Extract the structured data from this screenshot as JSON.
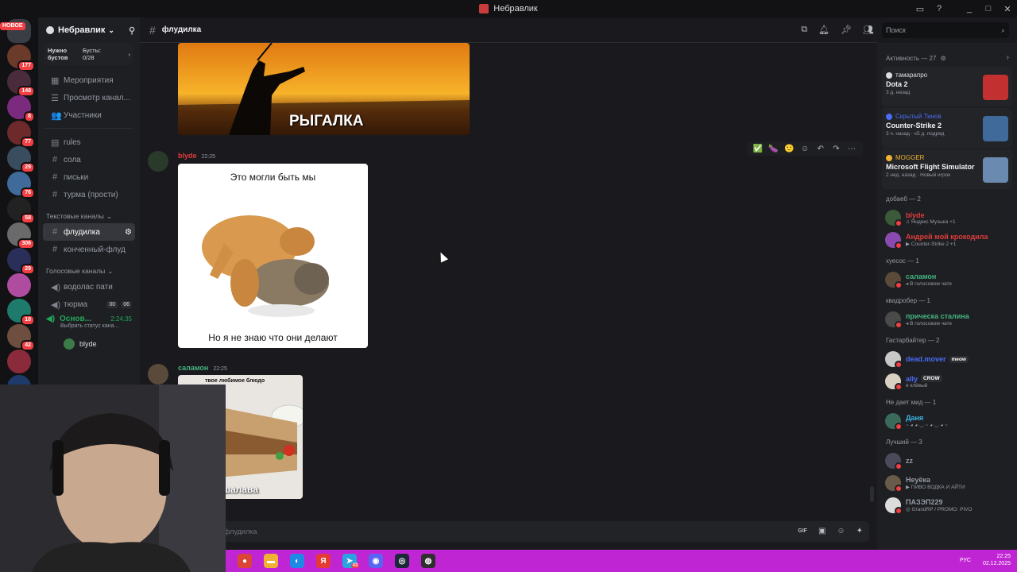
{
  "window": {
    "title": "Небравлик",
    "controls": [
      "_",
      "□",
      "✕"
    ]
  },
  "servers": [
    {
      "badge": "",
      "new_tag": "НОВОЕ",
      "color": "#3a3d44"
    },
    {
      "badge": "177",
      "color": "#6c3a2a"
    },
    {
      "badge": "148",
      "color": "#4a2b3c"
    },
    {
      "badge": "8",
      "color": "#7a2b7e"
    },
    {
      "badge": "77",
      "color": "#6e2a2a"
    },
    {
      "badge": "29",
      "color": "#3a4d5e"
    },
    {
      "badge": "76",
      "color": "#3f6a9a"
    },
    {
      "badge": "58",
      "color": "#222"
    },
    {
      "badge": "306",
      "color": "#6a6a6a"
    },
    {
      "badge": "29",
      "color": "#2a2f5a"
    },
    {
      "badge": "",
      "color": "#b04ca0"
    },
    {
      "badge": "10",
      "color": "#1e7a6a"
    },
    {
      "badge": "42",
      "color": "#6e4e3e"
    },
    {
      "badge": "",
      "color": "#8a2a3a"
    },
    {
      "badge": "",
      "color": "#1e3a6a"
    }
  ],
  "server": {
    "name": "Небравлик",
    "boost_left": "Нужно бустов",
    "boost_right": "Бусты: 0/28",
    "top_items": [
      {
        "icon": "calendar-icon",
        "glyph": "▦",
        "label": "Мероприятия"
      },
      {
        "icon": "browse-channels-icon",
        "glyph": "☰",
        "label": "Просмотр канал..."
      },
      {
        "icon": "members-icon",
        "glyph": "👥",
        "label": "Участники"
      }
    ],
    "text_top": [
      {
        "glyph": "▤",
        "label": "rules"
      },
      {
        "glyph": "#",
        "label": "сола"
      },
      {
        "glyph": "#",
        "label": "письки"
      },
      {
        "glyph": "#",
        "label": "турма (прости)"
      }
    ],
    "text_category": "Текстовые каналы",
    "text_channels": [
      {
        "glyph": "#",
        "label": "флудилка",
        "active": true
      },
      {
        "glyph": "#",
        "label": "конченный-флуд",
        "active": false
      }
    ],
    "voice_category": "Голосовые каналы",
    "voice_channels": [
      {
        "label": "водолас пати"
      },
      {
        "label": "тюрма",
        "times": [
          "00",
          "06"
        ]
      }
    ],
    "voice_active": {
      "label": "Основ...",
      "time": "2:24:35",
      "status": "Выбрать статус кана..."
    },
    "voice_user": "blyde"
  },
  "header": {
    "channel": "флудилка",
    "search_placeholder": "Поиск"
  },
  "messages": [
    {
      "image_caption": "РЫГАЛКА"
    },
    {
      "author": "blyde",
      "time": "22:25",
      "author_color": "#e03c3c",
      "meme_top": "Это могли быть мы",
      "meme_bottom": "Но я не знаю что они делают"
    },
    {
      "author": "саламон",
      "time": "22:25",
      "author_color": "#43b581",
      "meme_top": "твое любимое блюдо",
      "meme_bottom": "шалава"
    }
  ],
  "hover_toolbar": [
    "✅",
    "🍆",
    "🙂",
    "☺",
    "↶",
    "↷",
    "⋯"
  ],
  "composer": {
    "placeholder": "флудилка",
    "icons": [
      "GIF",
      "▣",
      "☺",
      "✦"
    ]
  },
  "members": {
    "activity_title": "Активность — 27",
    "activities": [
      {
        "user": "тамарапро",
        "user_color": "#dbdee1",
        "game": "Dota 2",
        "detail": "3 д. назад",
        "icon_color": "#c23030"
      },
      {
        "user": "Скрытый Тинов",
        "user_color": "#4a6cf7",
        "game": "Counter-Strike 2",
        "detail": "3 ч. назад · x5 д. подряд",
        "icon_color": "#3f6a9a"
      },
      {
        "user": "MOGGER",
        "user_color": "#f0b232",
        "game": "Microsoft Flight Simulator",
        "detail": "2 нед. назад · Новый игрок",
        "icon_color": "#6a8ab0"
      }
    ],
    "groups": [
      {
        "role": "добаеб — 2",
        "members": [
          {
            "name": "blyde",
            "color": "#e03c3c",
            "status": "♫ Яндекс Музыка +1",
            "av": "#3a5a3a"
          },
          {
            "name": "Андрей мой крокодила",
            "color": "#e03c3c",
            "status": "▶ Counter-Strike 2 +1",
            "av": "#8a4ab0"
          }
        ]
      },
      {
        "role": "хуесос — 1",
        "members": [
          {
            "name": "саламон",
            "color": "#43b581",
            "status": "◂ В голосовом чате",
            "av": "#5a4a3a"
          }
        ]
      },
      {
        "role": "квадробер — 1",
        "members": [
          {
            "name": "прическа сталина",
            "color": "#43b581",
            "status": "◂ В голосовом чате",
            "av": "#4a4a4a"
          }
        ]
      },
      {
        "role": "Гастарбайтер — 2",
        "members": [
          {
            "name": "dead.mover",
            "color": "#4a6cf7",
            "status": "",
            "tag": "meow",
            "av": "#c8c8c8"
          },
          {
            "name": "ally",
            "color": "#4a6cf7",
            "status": "я клёвый",
            "tag": "CROW",
            "av": "#d8d0c0"
          }
        ]
      },
      {
        "role": "Не дает мид — 1",
        "members": [
          {
            "name": "Даня",
            "color": "#3db5e8",
            "status": "~ ◕ ◕ ◡ ~ ◕ ◡ ◕ ~",
            "av": "#3a6a5a"
          }
        ]
      },
      {
        "role": "Лучший — 3",
        "members": [
          {
            "name": "zz",
            "color": "#949ba4",
            "status": "",
            "av": "#4a4a5a"
          },
          {
            "name": "Неуёка",
            "color": "#949ba4",
            "status": "▶ ПИВО ВОДКА И АЙТИ",
            "av": "#6a5a4a"
          },
          {
            "name": "ПАЗЭП229",
            "color": "#949ba4",
            "status": "◎ GrandRP / PROMO: PIVO",
            "av": "#dcdcdc"
          }
        ]
      }
    ]
  },
  "taskbar": {
    "apps": [
      {
        "name": "chrome",
        "color": "#db4437",
        "glyph": "●"
      },
      {
        "name": "explorer",
        "color": "#f0b232",
        "glyph": "▬"
      },
      {
        "name": "edge",
        "color": "#1e88e5",
        "glyph": "◐"
      },
      {
        "name": "yandex",
        "color": "#e53935",
        "glyph": "Я"
      },
      {
        "name": "telegram",
        "color": "#2aa3e0",
        "glyph": "➤"
      },
      {
        "name": "discord",
        "color": "#5865f2",
        "glyph": "◉"
      },
      {
        "name": "steam",
        "color": "#1b2838",
        "glyph": "◎"
      },
      {
        "name": "obs",
        "color": "#302e31",
        "glyph": "◍"
      }
    ],
    "telegram_badge": "43",
    "lang": "РУС",
    "time": "22:25",
    "date": "02.12.2025"
  }
}
